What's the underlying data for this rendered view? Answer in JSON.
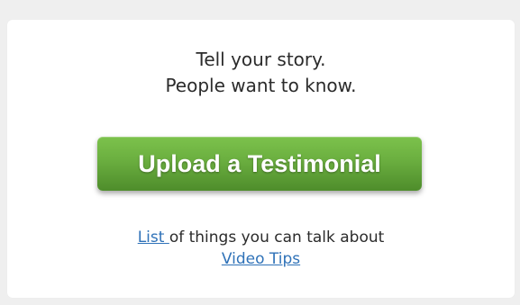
{
  "card": {
    "tagline_line1": "Tell your story.",
    "tagline_line2": "People want to know.",
    "upload_button_label": "Upload a Testimonial",
    "list_link_label": "List ",
    "list_suffix_text": "of things you can talk about",
    "video_tips_link_label": "Video Tips"
  },
  "colors": {
    "page_background": "#efefef",
    "card_background": "#ffffff",
    "button_green": "#6aae3f",
    "link_blue": "#2f72b8",
    "text": "#2b2b2b"
  }
}
